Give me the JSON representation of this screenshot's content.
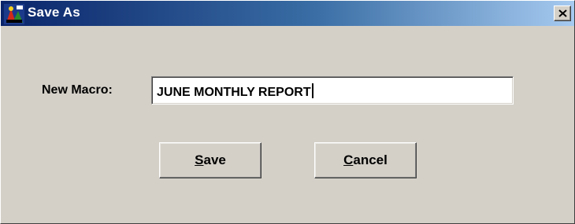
{
  "dialog": {
    "title": "Save As",
    "close_symbol": "×",
    "app_icon": "macro-app-icon"
  },
  "form": {
    "label": "New Macro:",
    "value": "JUNE MONTHLY REPORT"
  },
  "buttons": {
    "save": {
      "mnemonic": "S",
      "rest": "ave"
    },
    "cancel": {
      "mnemonic": "C",
      "rest": "ancel"
    }
  },
  "colors": {
    "titlebar_start": "#0a246a",
    "titlebar_end": "#a6caf0",
    "dialog_face": "#d4d0c8"
  }
}
